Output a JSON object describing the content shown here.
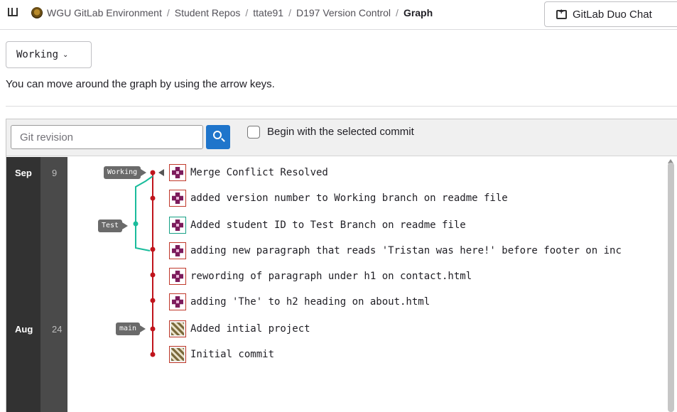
{
  "breadcrumb": {
    "items": [
      "WGU GitLab Environment",
      "Student Repos",
      "ttate91",
      "D197 Version Control"
    ],
    "separator": "/",
    "current": "Graph"
  },
  "header": {
    "duo_chat_label": "GitLab Duo Chat"
  },
  "branch_selector": {
    "value": "Working"
  },
  "hint_text": "You can move around the graph by using the arrow keys.",
  "search": {
    "placeholder": "Git revision",
    "begin_with_selected_label": "Begin with the selected commit",
    "begin_with_selected_checked": false
  },
  "dates": [
    {
      "month": "Sep",
      "day": "9"
    },
    {
      "month": "Aug",
      "day": "24"
    }
  ],
  "refs": [
    {
      "name": "Working",
      "commit_index": 0
    },
    {
      "name": "Test",
      "commit_index": 2
    },
    {
      "name": "main",
      "commit_index": 6
    }
  ],
  "commits": [
    {
      "message": "Merge Conflict Resolved",
      "avatar": "purple-identicon",
      "branch": "working"
    },
    {
      "message": "added version number to Working branch on readme file",
      "avatar": "purple-identicon",
      "branch": "working"
    },
    {
      "message": "Added student ID to Test Branch on readme file",
      "avatar": "purple-identicon",
      "branch": "test"
    },
    {
      "message": "adding new paragraph that reads 'Tristan was here!' before footer on inc",
      "avatar": "purple-identicon",
      "branch": "working"
    },
    {
      "message": "rewording of paragraph under h1 on contact.html",
      "avatar": "purple-identicon",
      "branch": "working"
    },
    {
      "message": "adding 'The' to h2 heading on about.html",
      "avatar": "purple-identicon",
      "branch": "working"
    },
    {
      "message": "Added intial project",
      "avatar": "brown-identicon",
      "branch": "main"
    },
    {
      "message": "Initial commit",
      "avatar": "brown-identicon",
      "branch": "main"
    }
  ],
  "colors": {
    "main_line": "#c0141c",
    "test_line": "#1abc9c",
    "search_button": "#1f75cb",
    "date_gutter": "#323232"
  }
}
